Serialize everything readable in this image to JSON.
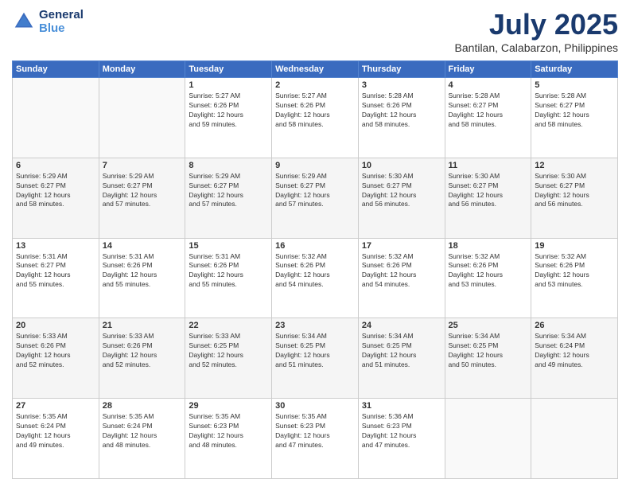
{
  "header": {
    "logo_line1": "General",
    "logo_line2": "Blue",
    "month": "July 2025",
    "location": "Bantilan, Calabarzon, Philippines"
  },
  "weekdays": [
    "Sunday",
    "Monday",
    "Tuesday",
    "Wednesday",
    "Thursday",
    "Friday",
    "Saturday"
  ],
  "weeks": [
    [
      {
        "day": "",
        "info": ""
      },
      {
        "day": "",
        "info": ""
      },
      {
        "day": "1",
        "info": "Sunrise: 5:27 AM\nSunset: 6:26 PM\nDaylight: 12 hours\nand 59 minutes."
      },
      {
        "day": "2",
        "info": "Sunrise: 5:27 AM\nSunset: 6:26 PM\nDaylight: 12 hours\nand 58 minutes."
      },
      {
        "day": "3",
        "info": "Sunrise: 5:28 AM\nSunset: 6:26 PM\nDaylight: 12 hours\nand 58 minutes."
      },
      {
        "day": "4",
        "info": "Sunrise: 5:28 AM\nSunset: 6:27 PM\nDaylight: 12 hours\nand 58 minutes."
      },
      {
        "day": "5",
        "info": "Sunrise: 5:28 AM\nSunset: 6:27 PM\nDaylight: 12 hours\nand 58 minutes."
      }
    ],
    [
      {
        "day": "6",
        "info": "Sunrise: 5:29 AM\nSunset: 6:27 PM\nDaylight: 12 hours\nand 58 minutes."
      },
      {
        "day": "7",
        "info": "Sunrise: 5:29 AM\nSunset: 6:27 PM\nDaylight: 12 hours\nand 57 minutes."
      },
      {
        "day": "8",
        "info": "Sunrise: 5:29 AM\nSunset: 6:27 PM\nDaylight: 12 hours\nand 57 minutes."
      },
      {
        "day": "9",
        "info": "Sunrise: 5:29 AM\nSunset: 6:27 PM\nDaylight: 12 hours\nand 57 minutes."
      },
      {
        "day": "10",
        "info": "Sunrise: 5:30 AM\nSunset: 6:27 PM\nDaylight: 12 hours\nand 56 minutes."
      },
      {
        "day": "11",
        "info": "Sunrise: 5:30 AM\nSunset: 6:27 PM\nDaylight: 12 hours\nand 56 minutes."
      },
      {
        "day": "12",
        "info": "Sunrise: 5:30 AM\nSunset: 6:27 PM\nDaylight: 12 hours\nand 56 minutes."
      }
    ],
    [
      {
        "day": "13",
        "info": "Sunrise: 5:31 AM\nSunset: 6:27 PM\nDaylight: 12 hours\nand 55 minutes."
      },
      {
        "day": "14",
        "info": "Sunrise: 5:31 AM\nSunset: 6:26 PM\nDaylight: 12 hours\nand 55 minutes."
      },
      {
        "day": "15",
        "info": "Sunrise: 5:31 AM\nSunset: 6:26 PM\nDaylight: 12 hours\nand 55 minutes."
      },
      {
        "day": "16",
        "info": "Sunrise: 5:32 AM\nSunset: 6:26 PM\nDaylight: 12 hours\nand 54 minutes."
      },
      {
        "day": "17",
        "info": "Sunrise: 5:32 AM\nSunset: 6:26 PM\nDaylight: 12 hours\nand 54 minutes."
      },
      {
        "day": "18",
        "info": "Sunrise: 5:32 AM\nSunset: 6:26 PM\nDaylight: 12 hours\nand 53 minutes."
      },
      {
        "day": "19",
        "info": "Sunrise: 5:32 AM\nSunset: 6:26 PM\nDaylight: 12 hours\nand 53 minutes."
      }
    ],
    [
      {
        "day": "20",
        "info": "Sunrise: 5:33 AM\nSunset: 6:26 PM\nDaylight: 12 hours\nand 52 minutes."
      },
      {
        "day": "21",
        "info": "Sunrise: 5:33 AM\nSunset: 6:26 PM\nDaylight: 12 hours\nand 52 minutes."
      },
      {
        "day": "22",
        "info": "Sunrise: 5:33 AM\nSunset: 6:25 PM\nDaylight: 12 hours\nand 52 minutes."
      },
      {
        "day": "23",
        "info": "Sunrise: 5:34 AM\nSunset: 6:25 PM\nDaylight: 12 hours\nand 51 minutes."
      },
      {
        "day": "24",
        "info": "Sunrise: 5:34 AM\nSunset: 6:25 PM\nDaylight: 12 hours\nand 51 minutes."
      },
      {
        "day": "25",
        "info": "Sunrise: 5:34 AM\nSunset: 6:25 PM\nDaylight: 12 hours\nand 50 minutes."
      },
      {
        "day": "26",
        "info": "Sunrise: 5:34 AM\nSunset: 6:24 PM\nDaylight: 12 hours\nand 49 minutes."
      }
    ],
    [
      {
        "day": "27",
        "info": "Sunrise: 5:35 AM\nSunset: 6:24 PM\nDaylight: 12 hours\nand 49 minutes."
      },
      {
        "day": "28",
        "info": "Sunrise: 5:35 AM\nSunset: 6:24 PM\nDaylight: 12 hours\nand 48 minutes."
      },
      {
        "day": "29",
        "info": "Sunrise: 5:35 AM\nSunset: 6:23 PM\nDaylight: 12 hours\nand 48 minutes."
      },
      {
        "day": "30",
        "info": "Sunrise: 5:35 AM\nSunset: 6:23 PM\nDaylight: 12 hours\nand 47 minutes."
      },
      {
        "day": "31",
        "info": "Sunrise: 5:36 AM\nSunset: 6:23 PM\nDaylight: 12 hours\nand 47 minutes."
      },
      {
        "day": "",
        "info": ""
      },
      {
        "day": "",
        "info": ""
      }
    ]
  ]
}
